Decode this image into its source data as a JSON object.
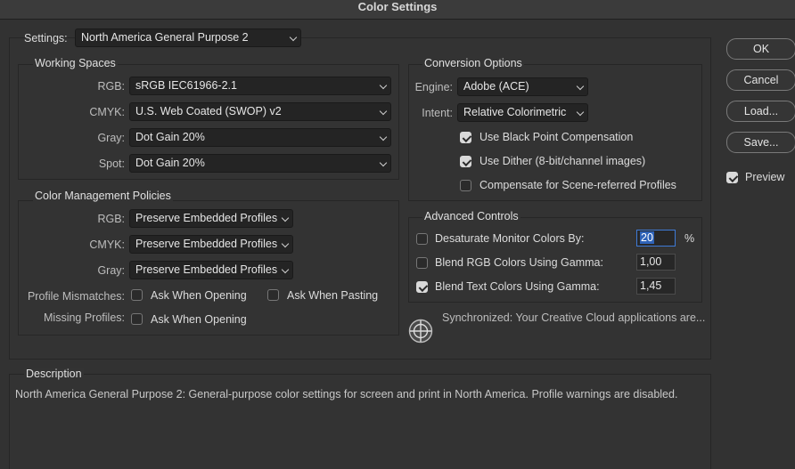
{
  "window": {
    "title": "Color Settings"
  },
  "settings": {
    "label": "Settings:",
    "value": "North America General Purpose 2"
  },
  "working_spaces": {
    "title": "Working Spaces",
    "rows": [
      {
        "label": "RGB:",
        "value": "sRGB IEC61966-2.1"
      },
      {
        "label": "CMYK:",
        "value": "U.S. Web Coated (SWOP) v2"
      },
      {
        "label": "Gray:",
        "value": "Dot Gain 20%"
      },
      {
        "label": "Spot:",
        "value": "Dot Gain 20%"
      }
    ]
  },
  "policies": {
    "title": "Color Management Policies",
    "rows": [
      {
        "label": "RGB:",
        "value": "Preserve Embedded Profiles"
      },
      {
        "label": "CMYK:",
        "value": "Preserve Embedded Profiles"
      },
      {
        "label": "Gray:",
        "value": "Preserve Embedded Profiles"
      }
    ],
    "mismatch_label": "Profile Mismatches:",
    "ask_opening": "Ask When Opening",
    "ask_pasting": "Ask When Pasting",
    "missing_label": "Missing Profiles:",
    "missing_ask_opening": "Ask When Opening"
  },
  "conversion": {
    "title": "Conversion Options",
    "engine_label": "Engine:",
    "engine_value": "Adobe (ACE)",
    "intent_label": "Intent:",
    "intent_value": "Relative Colorimetric",
    "black_point": "Use Black Point Compensation",
    "dither": "Use Dither (8-bit/channel images)",
    "scene_referred": "Compensate for Scene-referred Profiles"
  },
  "advanced": {
    "title": "Advanced Controls",
    "desaturate_label": "Desaturate Monitor Colors By:",
    "desaturate_value": "20",
    "percent": "%",
    "blend_rgb_label": "Blend RGB Colors Using Gamma:",
    "blend_rgb_value": "1,00",
    "blend_text_label": "Blend Text Colors Using Gamma:",
    "blend_text_value": "1,45"
  },
  "sync": {
    "text": "Synchronized: Your Creative Cloud applications are..."
  },
  "description": {
    "title": "Description",
    "text": "North America General Purpose 2:  General-purpose color settings for screen and print in North America. Profile warnings are disabled."
  },
  "buttons": {
    "ok": "OK",
    "cancel": "Cancel",
    "load": "Load...",
    "save": "Save...",
    "preview": "Preview"
  }
}
